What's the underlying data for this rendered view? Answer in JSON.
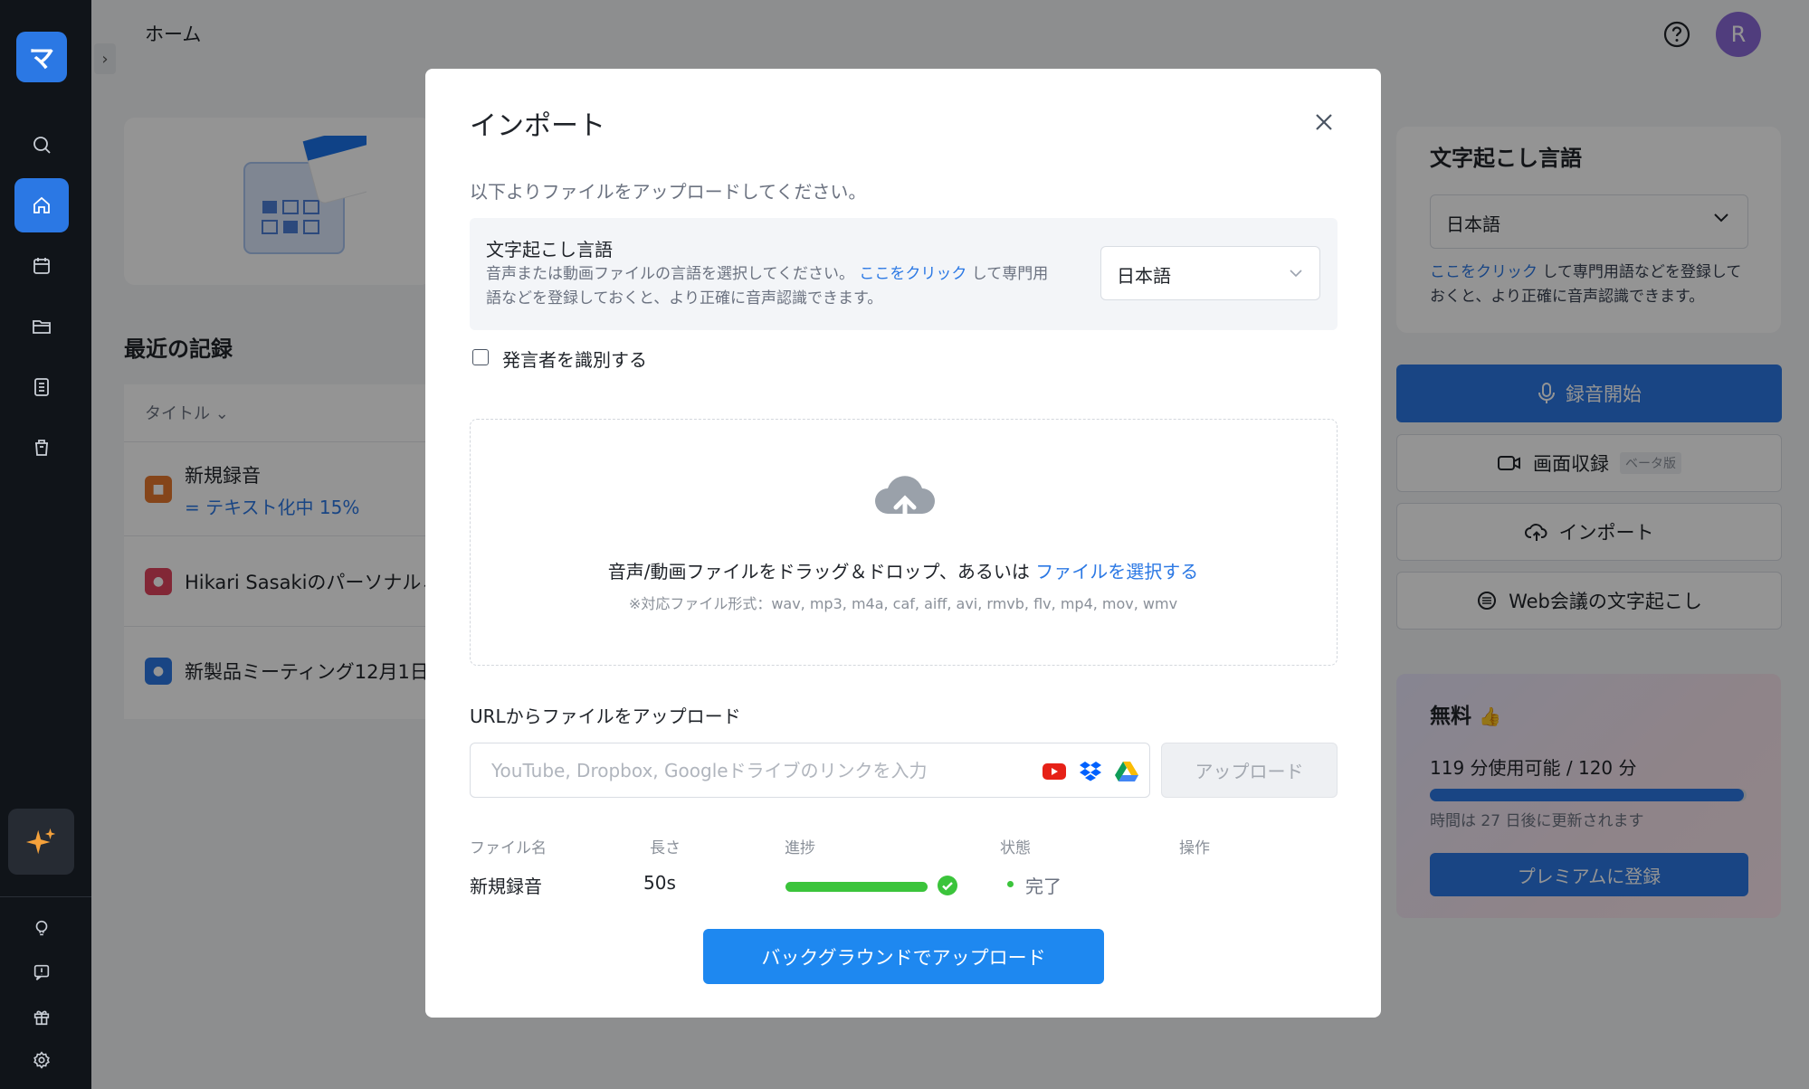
{
  "app": {
    "logo_letter": "マ",
    "accent": "#2b78e4"
  },
  "sidebar": {
    "items": [
      {
        "name": "search-icon"
      },
      {
        "name": "home-icon",
        "active": true
      },
      {
        "name": "calendar-icon"
      },
      {
        "name": "folder-icon"
      },
      {
        "name": "document-icon"
      },
      {
        "name": "trash-icon"
      }
    ],
    "bottom": [
      {
        "name": "lightbulb-icon"
      },
      {
        "name": "feedback-icon"
      },
      {
        "name": "gift-icon"
      },
      {
        "name": "settings-icon"
      }
    ]
  },
  "topbar": {
    "title": "ホーム",
    "avatar_letter": "R"
  },
  "recent": {
    "title": "最近の記録",
    "column_title": "タイトル",
    "rows": [
      {
        "title": "新規録音",
        "sub": "= テキスト化中 15%",
        "icon": "camera-icon",
        "color": "#e6772e"
      },
      {
        "title": "Hikari Sasakiのパーソナルミ",
        "icon": "meeting-icon",
        "color": "#e0445e"
      },
      {
        "title": "新製品ミーティング12月1日",
        "icon": "mic-icon",
        "color": "#2b78e4"
      }
    ]
  },
  "right_panel": {
    "lang_title": "文字起こし言語",
    "lang_value": "日本語",
    "note_link": "ここをクリック",
    "note_text": " して専門用語などを登録しておくと、より正確に音声認識できます。",
    "record_label": "録音開始",
    "screen_label": "画面収録",
    "beta_label": "ベータ版",
    "import_label": "インポート",
    "web_label": "Web会議の文字起こし",
    "plan_title": "無料",
    "plan_usage": "119 分使用可能 / 120 分",
    "plan_fraction": 0.99,
    "plan_reset": "時間は 27 日後に更新されます",
    "premium_label": "プレミアムに登録"
  },
  "modal": {
    "title": "インポート",
    "subtitle": "以下よりファイルをアップロードしてください。",
    "lang_title": "文字起こし言語",
    "lang_desc_before": "音声または動画ファイルの言語を選択してください。",
    "lang_desc_link": "ここをクリック",
    "lang_desc_after": " して専門用語などを登録しておくと、より正確に音声認識できます。",
    "lang_value": "日本語",
    "speaker_label": "発言者を識別する",
    "drop_text": "音声/動画ファイルをドラッグ＆ドロップ、あるいは",
    "drop_link": "ファイルを選択する",
    "drop_formats": "※対応ファイル形式：wav, mp3, m4a, caf, aiff, avi, rmvb, flv, mp4, mov, wmv",
    "url_title": "URLからファイルをアップロード",
    "url_placeholder": "YouTube, Dropbox, Googleドライブのリンクを入力",
    "upload_label": "アップロード",
    "table_headers": {
      "name": "ファイル名",
      "length": "長さ",
      "progress": "進捗",
      "status": "状態",
      "action": "操作"
    },
    "file": {
      "name": "新規録音",
      "length": "50s",
      "progress": 1.0,
      "status": "完了"
    },
    "bg_upload_label": "バックグラウンドでアップロード"
  }
}
